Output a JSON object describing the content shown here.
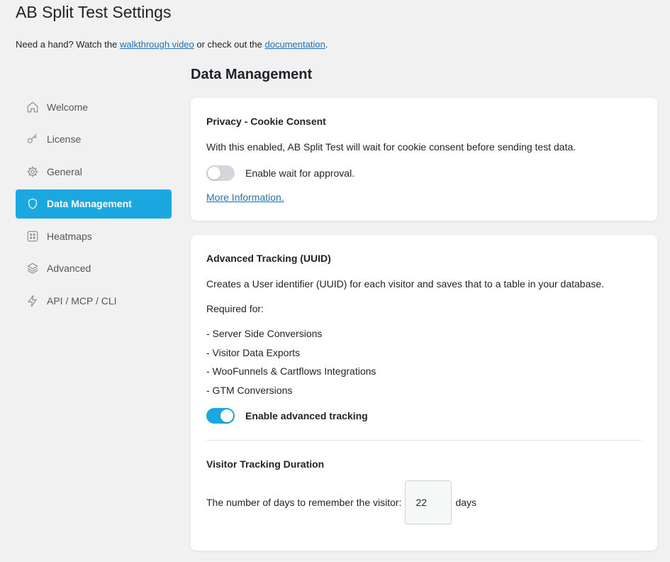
{
  "header": {
    "title": "AB Split Test Settings",
    "help_prefix": "Need a hand? Watch the",
    "walkthrough_link": "walkthrough video",
    "help_middle": "or check out the",
    "documentation_link": "documentation",
    "help_suffix": "."
  },
  "sidebar": {
    "items": [
      {
        "label": "Welcome",
        "icon": "home-icon"
      },
      {
        "label": "License",
        "icon": "key-icon"
      },
      {
        "label": "General",
        "icon": "gear-icon"
      },
      {
        "label": "Data Management",
        "icon": "shield-icon",
        "active": true
      },
      {
        "label": "Heatmaps",
        "icon": "grid-icon"
      },
      {
        "label": "Advanced",
        "icon": "layers-icon"
      },
      {
        "label": "API / MCP / CLI",
        "icon": "lightning-icon"
      }
    ]
  },
  "main": {
    "section_title": "Data Management",
    "privacy": {
      "heading": "Privacy - Cookie Consent",
      "description": "With this enabled, AB Split Test will wait for cookie consent before sending test data.",
      "toggle_label": "Enable wait for approval.",
      "toggle_on": false,
      "more_link": "More Information."
    },
    "tracking": {
      "heading": "Advanced Tracking (UUID)",
      "description": "Creates a User identifier (UUID) for each visitor and saves that to a table in your database.",
      "required_for": "Required for:",
      "requirements": [
        "- Server Side Conversions",
        "- Visitor Data Exports",
        "- WooFunnels & Cartflows Integrations",
        "- GTM Conversions"
      ],
      "toggle_label": "Enable advanced tracking",
      "toggle_on": true,
      "duration_heading": "Visitor Tracking Duration",
      "duration_label": "The number of days to remember the visitor:",
      "duration_value": "22",
      "duration_unit": "days"
    }
  },
  "colors": {
    "accent": "#1ba7e0",
    "link": "#2271b1",
    "background": "#f1f1f1"
  }
}
